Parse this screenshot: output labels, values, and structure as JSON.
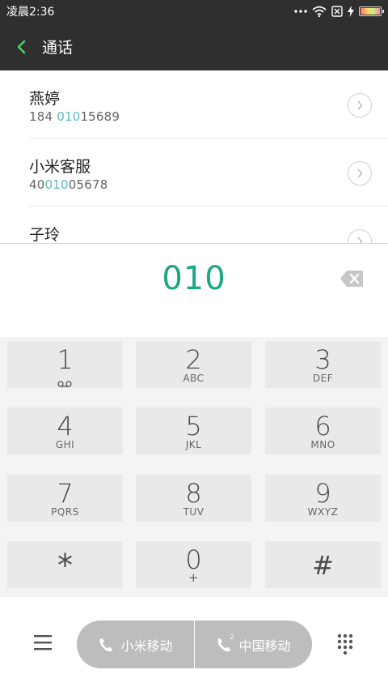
{
  "status_bar": {
    "time": "凌晨2:36",
    "icons": [
      "more-dots-icon",
      "wifi-icon",
      "no-sim-icon",
      "charging-icon",
      "battery-icon"
    ]
  },
  "title_bar": {
    "back_icon": "chevron-left-icon",
    "title": "通话",
    "accent_color": "#4cd964"
  },
  "results": [
    {
      "name": "燕婷",
      "number_parts": [
        "184 ",
        "010",
        "15689"
      ]
    },
    {
      "name": "小米客服",
      "number_parts": [
        "40",
        "010",
        "05678"
      ]
    },
    {
      "name": "子玲",
      "number_parts": [
        "",
        "",
        ""
      ]
    }
  ],
  "dialer": {
    "number": "010",
    "number_color": "#1ba784",
    "highlight_color": "#5fb8c8"
  },
  "keypad": {
    "keys": [
      {
        "digit": "1",
        "letters": ""
      },
      {
        "digit": "2",
        "letters": "ABC"
      },
      {
        "digit": "3",
        "letters": "DEF"
      },
      {
        "digit": "4",
        "letters": "GHI"
      },
      {
        "digit": "5",
        "letters": "JKL"
      },
      {
        "digit": "6",
        "letters": "MNO"
      },
      {
        "digit": "7",
        "letters": "PQRS"
      },
      {
        "digit": "8",
        "letters": "TUV"
      },
      {
        "digit": "9",
        "letters": "WXYZ"
      },
      {
        "digit": "*",
        "letters": ""
      },
      {
        "digit": "0",
        "letters": "+"
      },
      {
        "digit": "#",
        "letters": ""
      }
    ]
  },
  "bottom_bar": {
    "sim1_label": "小米移动",
    "sim2_label": "中国移动",
    "sim2_index": "2",
    "menu_icon": "menu-icon",
    "dialpad_icon": "dialpad-grid-icon"
  }
}
